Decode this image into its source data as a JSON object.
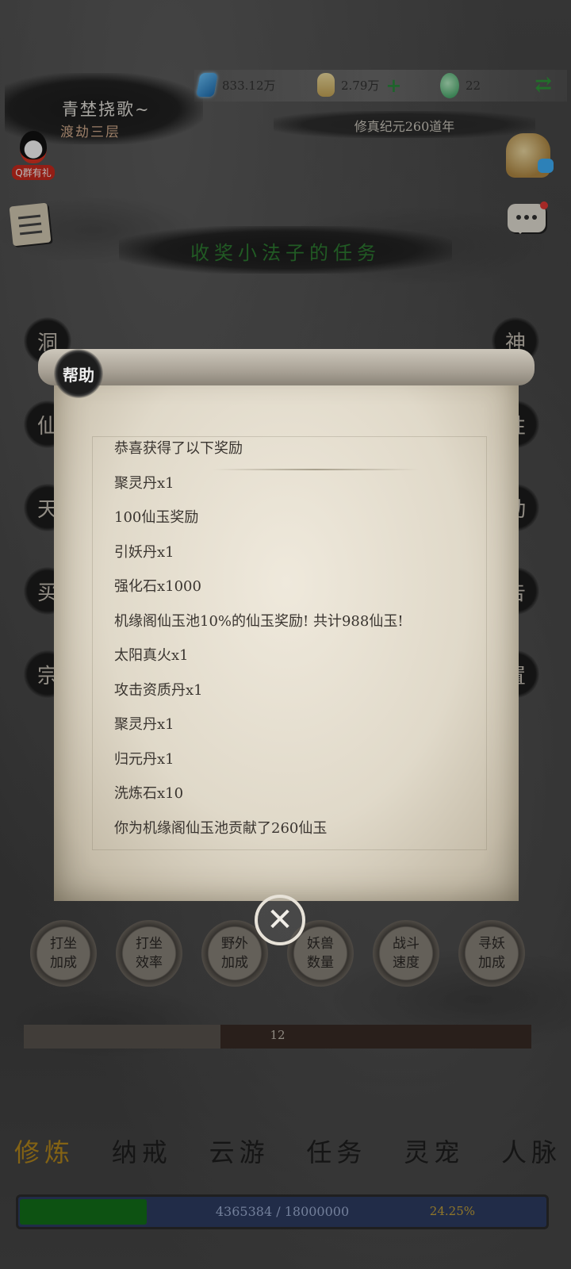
{
  "player": {
    "name": "青埜挠歌~",
    "rank": "渡劫三层"
  },
  "resources": {
    "gems": "833.12万",
    "coins": "2.79万",
    "jade": "22"
  },
  "era": "修真纪元260道年",
  "qq_group": "Q群有礼",
  "task_banner": "收奖小法子的任务",
  "side_buttons": {
    "left": [
      "洞",
      "仙",
      "天",
      "买",
      "宗"
    ],
    "right": [
      "神",
      "性",
      "动",
      "告",
      "置"
    ]
  },
  "action_buttons": [
    "打坐加成",
    "打坐效率",
    "野外加成",
    "妖兽数量",
    "战斗速度",
    "寻妖加成"
  ],
  "progress": {
    "value_text": "12"
  },
  "bottom_nav": [
    "修炼",
    "纳戒",
    "云游",
    "任务",
    "灵宠",
    "人脉"
  ],
  "exp": {
    "current": "4365384",
    "max": "18000000",
    "separator": "/",
    "percent": "24.25%",
    "fraction": 0.2425
  },
  "modal": {
    "badge": "帮助",
    "lines": [
      "恭喜获得了以下奖励",
      "聚灵丹x1",
      "100仙玉奖励",
      "引妖丹x1",
      "强化石x1000",
      "机缘阁仙玉池10%的仙玉奖励! 共计988仙玉!",
      "太阳真火x1",
      "攻击资质丹x1",
      "聚灵丹x1",
      "归元丹x1",
      "洗炼石x10",
      "你为机缘阁仙玉池贡献了260仙玉"
    ],
    "close_symbol": "✕"
  },
  "colors": {
    "accent_green": "#2e7d32",
    "nav_active": "#b88a1d",
    "exp_fill": "#12721a"
  }
}
